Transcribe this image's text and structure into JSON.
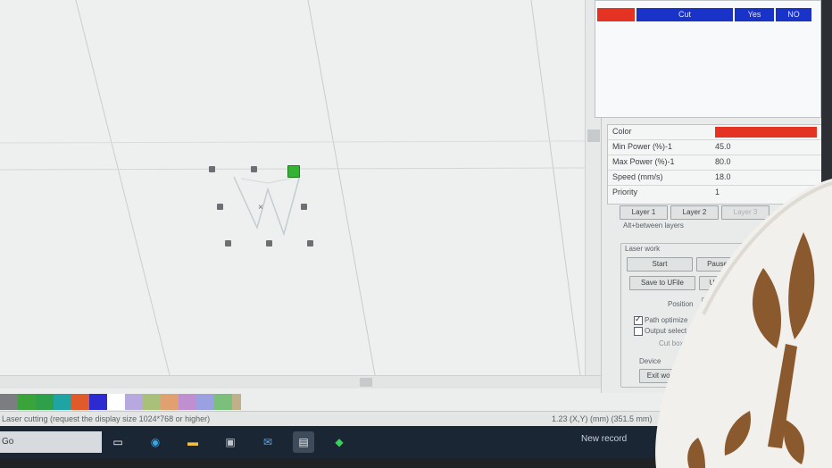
{
  "layers_table": {
    "rows": [
      {
        "mode": "Cut",
        "output": "Yes",
        "hide": "NO",
        "color": "#e53323"
      }
    ]
  },
  "properties": {
    "color_label": "Color",
    "color_value": "#e53323",
    "rows": [
      {
        "label": "Min Power (%)-1",
        "value": "45.0"
      },
      {
        "label": "Max Power (%)-1",
        "value": "80.0"
      },
      {
        "label": "Speed (mm/s)",
        "value": "18.0"
      },
      {
        "label": "Priority",
        "value": "1"
      }
    ]
  },
  "layer_buttons": [
    "Layer 1",
    "Layer 2",
    "Layer 3"
  ],
  "layer_hint": "Alt+between layers",
  "laser_work": {
    "title": "Laser work",
    "start_label": "Start",
    "pause_label": "Pause/Cont",
    "save_label": "Save to UFile",
    "ufile_label": "UFile",
    "position_label": "Position",
    "path_optimize_label": "Path optimize",
    "path_optimize_checked": true,
    "select_graphics_label": "Output select graphics",
    "select_graphics_checked": false,
    "cut_box_label": "Cut box",
    "device_label": "Device",
    "exit_label": "Exit work"
  },
  "palette": [
    "#7b7d80",
    "#3aa33a",
    "#2fa04a",
    "#1fa3a3",
    "#e05a2a",
    "#2c2ad0",
    "#ffffff",
    "#b7a8e0",
    "#a9c07a",
    "#e0a070",
    "#c08fd0",
    "#9aa0e0",
    "#7ac07a",
    "#c0b08a"
  ],
  "status": {
    "message": "Laser cutting (request the display size 1024*768 or higher)",
    "coords": "1.23 (X,Y) (mm) (351.5 mm)"
  },
  "taskbar": {
    "search": "Go",
    "news": "New record"
  }
}
